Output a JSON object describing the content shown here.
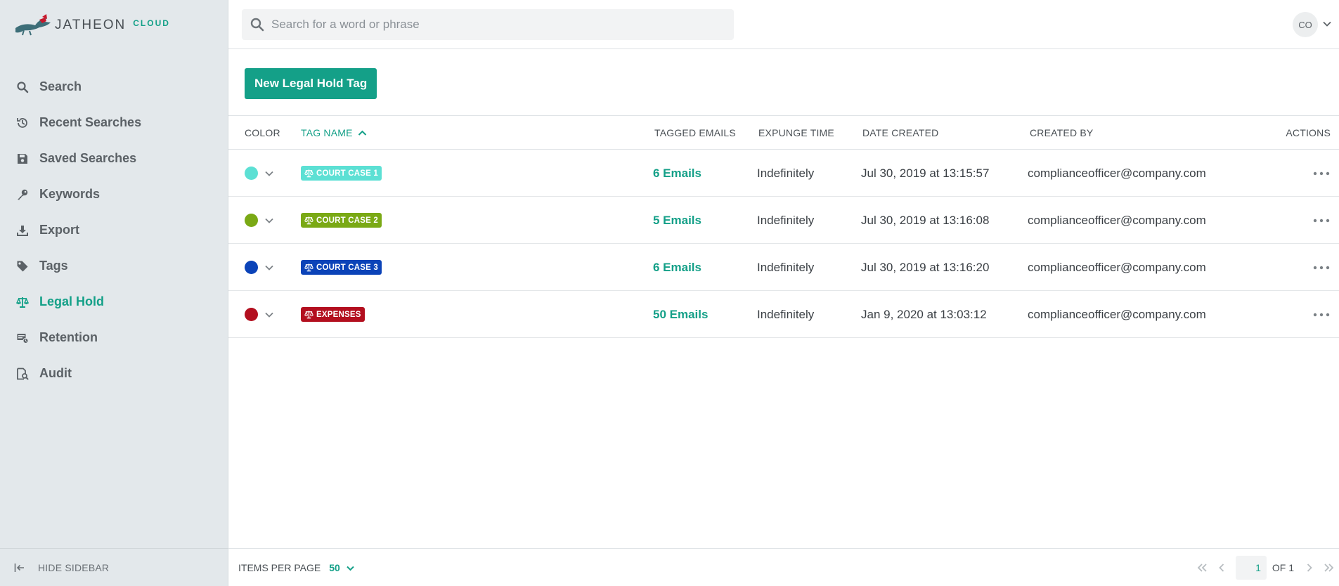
{
  "app": {
    "logo_text": "JATHEON",
    "logo_suffix": "CLOUD"
  },
  "sidebar": {
    "items": [
      {
        "label": "Search",
        "icon": "search-icon"
      },
      {
        "label": "Recent Searches",
        "icon": "history-icon"
      },
      {
        "label": "Saved Searches",
        "icon": "save-icon"
      },
      {
        "label": "Keywords",
        "icon": "key-icon"
      },
      {
        "label": "Export",
        "icon": "download-icon"
      },
      {
        "label": "Tags",
        "icon": "tag-icon"
      },
      {
        "label": "Legal Hold",
        "icon": "scale-icon",
        "active": true
      },
      {
        "label": "Retention",
        "icon": "retention-icon"
      },
      {
        "label": "Audit",
        "icon": "audit-icon"
      }
    ],
    "hide_label": "HIDE SIDEBAR"
  },
  "search": {
    "placeholder": "Search for a word or phrase"
  },
  "user": {
    "initials": "CO"
  },
  "toolbar": {
    "new_button_label": "New Legal Hold Tag"
  },
  "table": {
    "headers": {
      "color": "COLOR",
      "tag_name": "TAG NAME",
      "tagged_emails": "TAGGED EMAILS",
      "expunge_time": "EXPUNGE TIME",
      "date_created": "DATE CREATED",
      "created_by": "CREATED BY",
      "actions": "ACTIONS"
    },
    "rows": [
      {
        "color": "#5ce0d4",
        "tag": "COURT CASE 1",
        "emails": "6 Emails",
        "expunge": "Indefinitely",
        "date": "Jul 30, 2019 at 13:15:57",
        "by": "complianceofficer@company.com"
      },
      {
        "color": "#7aa915",
        "tag": "COURT CASE 2",
        "emails": "5 Emails",
        "expunge": "Indefinitely",
        "date": "Jul 30, 2019 at 13:16:08",
        "by": "complianceofficer@company.com"
      },
      {
        "color": "#0b43b8",
        "tag": "COURT CASE 3",
        "emails": "6 Emails",
        "expunge": "Indefinitely",
        "date": "Jul 30, 2019 at 13:16:20",
        "by": "complianceofficer@company.com"
      },
      {
        "color": "#b30f1f",
        "tag": "EXPENSES",
        "emails": "50 Emails",
        "expunge": "Indefinitely",
        "date": "Jan 9, 2020 at 13:03:12",
        "by": "complianceofficer@company.com"
      }
    ]
  },
  "footer": {
    "items_per_page_label": "ITEMS PER PAGE",
    "items_per_page_value": "50",
    "current_page": "1",
    "of_label": "OF 1"
  },
  "colors": {
    "accent": "#14a088",
    "sidebar_bg": "#e3e8eb"
  }
}
